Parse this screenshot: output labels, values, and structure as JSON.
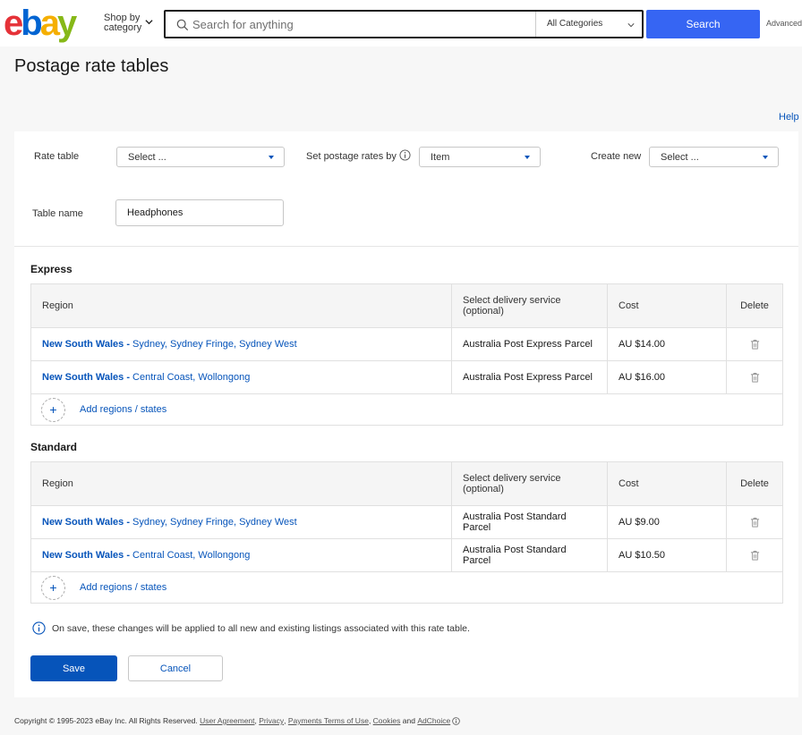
{
  "header": {
    "shop_by_line1": "Shop by",
    "shop_by_line2": "category",
    "search_placeholder": "Search for anything",
    "category": "All Categories",
    "search_button": "Search",
    "advanced": "Advanced"
  },
  "page_title": "Postage rate tables",
  "help": "Help",
  "form": {
    "rate_table_label": "Rate table",
    "rate_table_value": "Select ...",
    "set_rates_label": "Set postage rates by",
    "set_rates_value": "Item",
    "create_new_label": "Create new",
    "create_new_value": "Select ...",
    "table_name_label": "Table name",
    "table_name_value": "Headphones"
  },
  "columns": {
    "region": "Region",
    "service_line1": "Select delivery service",
    "service_line2": "(optional)",
    "cost": "Cost",
    "delete": "Delete"
  },
  "express": {
    "title": "Express",
    "rows": [
      {
        "state": "New South Wales -",
        "areas": " Sydney, Sydney Fringe, Sydney West",
        "service": "Australia Post Express Parcel",
        "cost": "AU $14.00"
      },
      {
        "state": "New South Wales -",
        "areas": " Central Coast, Wollongong",
        "service": "Australia Post Express Parcel",
        "cost": "AU $16.00"
      }
    ],
    "add_label": "Add regions / states"
  },
  "standard": {
    "title": "Standard",
    "rows": [
      {
        "state": "New South Wales -",
        "areas": " Sydney, Sydney Fringe, Sydney West",
        "service": "Australia Post Standard Parcel",
        "cost": "AU $9.00"
      },
      {
        "state": "New South Wales -",
        "areas": " Central Coast, Wollongong",
        "service": "Australia Post Standard Parcel",
        "cost": "AU $10.50"
      }
    ],
    "add_label": "Add regions / states"
  },
  "notice": "On save, these changes will be applied to all new and existing listings associated with this rate table.",
  "buttons": {
    "save": "Save",
    "cancel": "Cancel"
  },
  "footer": {
    "copyright": "Copyright © 1995-2023 eBay Inc. All Rights Reserved.",
    "user_agreement": "User Agreement",
    "privacy": "Privacy",
    "payments": "Payments Terms of Use",
    "cookies": "Cookies",
    "and": "and",
    "adchoice": "AdChoice"
  },
  "colors": {
    "search_button": "#3665f3",
    "link": "#0654ba",
    "save_button": "#0654ba"
  }
}
